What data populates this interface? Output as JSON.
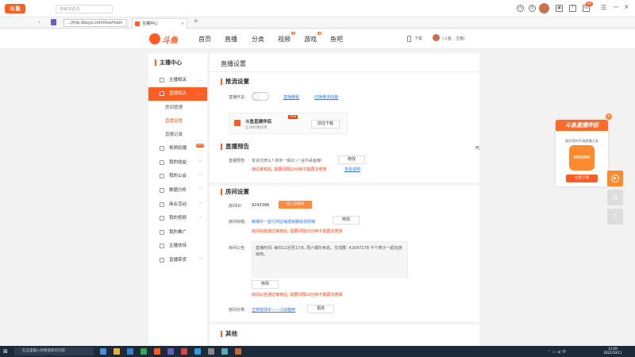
{
  "browser": {
    "logo_text": "斗鱼",
    "search_placeholder": "搜索关键词",
    "address": "...//mp.douyu.com/live/main",
    "tab_title": "主播中心",
    "notif_count": "99"
  },
  "site": {
    "logo_text": "斗鱼",
    "nav": [
      "首页",
      "直播",
      "分类",
      "视频",
      "游戏",
      "鱼吧"
    ],
    "download_label": "下载",
    "user_label": "(斗鱼 · 主播)"
  },
  "sidebar": {
    "title": "主播中心",
    "items": [
      {
        "label": "主播相关"
      },
      {
        "label": "直播相关"
      },
      {
        "label": "房间管理"
      },
      {
        "label": "直播设置"
      },
      {
        "label": "直播记录"
      },
      {
        "label": "视频轮播"
      },
      {
        "label": "我的收益"
      },
      {
        "label": "我的公会"
      },
      {
        "label": "数据分析"
      },
      {
        "label": "商业活动"
      },
      {
        "label": "我的视频"
      },
      {
        "label": "我的推广"
      },
      {
        "label": "主播扶持"
      },
      {
        "label": "直播带货"
      }
    ],
    "new_badge": "NEW"
  },
  "main": {
    "page_title": "直播设置",
    "stream": {
      "section_title": "推流设置",
      "switch_label": "直播开关:",
      "tutorial_link": "直播教程",
      "switch_line_link": "切换推流线路",
      "companion_title": "斗鱼直播伴侣",
      "companion_sub": "让OBS更好用",
      "companion_badge": "NEW",
      "companion_button": "前往下载"
    },
    "notice": {
      "section_title": "直播预告",
      "label": "直播预告:",
      "value": "有货光修么? 商务一相识~! 谷外承鱼粮!",
      "edit_button": "修改",
      "warning": "通过审核后, 需要间隔10分钟才能再次修改",
      "rule_link": "查看说明"
    },
    "room": {
      "section_title": "房间设置",
      "id_label": "房间ID:",
      "id_value": "9243396",
      "enter_button": "进入直播间",
      "title_label": "房间标题:",
      "title_value": "鲸播中一屋行商店铺连锁路底视频播",
      "title_edit": "修改",
      "title_warning": "房间标题通过审核后, 需要间隔10分钟才能再次修改",
      "announce_label": "房间公告:",
      "announce_value": "直播时间: 每日12点至17点, 周六偶尔休息。交流群: 41647178 卡个牌子一起玩游戏吧。",
      "announce_edit": "修改",
      "announce_warning": "房间公告通过审核后, 需要间隔10分钟才能再次修改",
      "category_label": "房间分类:",
      "category_value": "王牌猎球手——江战猫两",
      "category_change": "更改"
    },
    "other": {
      "section_title": "其他"
    }
  },
  "promo": {
    "title": "斗鱼直播伴侣",
    "desc": "超好用的PC端直播工具",
    "button": "立即下载",
    "icon_text": "DOUYU"
  },
  "taskbar": {
    "search_placeholder": "在这里输入你要搜索的内容",
    "time": "12:09",
    "date": "2022/10/11"
  },
  "colors": {
    "accent": "#ff5d23",
    "link": "#2b7de9",
    "warning": "#ff3c00"
  }
}
